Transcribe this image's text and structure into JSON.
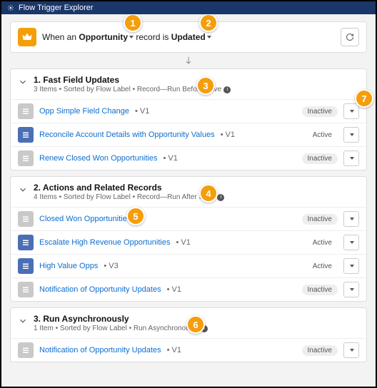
{
  "title": "Flow Trigger Explorer",
  "trigger": {
    "prefix": "When an",
    "object": "Opportunity",
    "mid": "record is",
    "operation": "Updated"
  },
  "sections": [
    {
      "title": "1. Fast Field Updates",
      "subtitle": "3 Items • Sorted by Flow Label • Record—Run Before Save",
      "rows": [
        {
          "name": "Opp Simple Field Change",
          "version": "V1",
          "status": "Inactive",
          "active": false
        },
        {
          "name": "Reconcile Account Details with Opportunity Values",
          "version": "V1",
          "status": "Active",
          "active": true
        },
        {
          "name": "Renew Closed Won Opportunities",
          "version": "V1",
          "status": "Inactive",
          "active": false
        }
      ]
    },
    {
      "title": "2. Actions and Related Records",
      "subtitle": "4 Items • Sorted by Flow Label • Record—Run After Save",
      "rows": [
        {
          "name": "Closed Won Opportunities",
          "version": "",
          "status": "Inactive",
          "active": false
        },
        {
          "name": "Escalate High Revenue Opportunities",
          "version": "V1",
          "status": "Active",
          "active": true
        },
        {
          "name": "High Value Opps",
          "version": "V3",
          "status": "Active",
          "active": true
        },
        {
          "name": "Notification of Opportunity Updates",
          "version": "V1",
          "status": "Inactive",
          "active": false
        }
      ]
    },
    {
      "title": "3. Run Asynchronously",
      "subtitle": "1 Item • Sorted by Flow Label • Run Asynchronously",
      "rows": [
        {
          "name": "Notification of Opportunity Updates",
          "version": "V1",
          "status": "Inactive",
          "active": false
        }
      ]
    }
  ],
  "callouts": [
    "1",
    "2",
    "3",
    "4",
    "5",
    "6",
    "7"
  ]
}
